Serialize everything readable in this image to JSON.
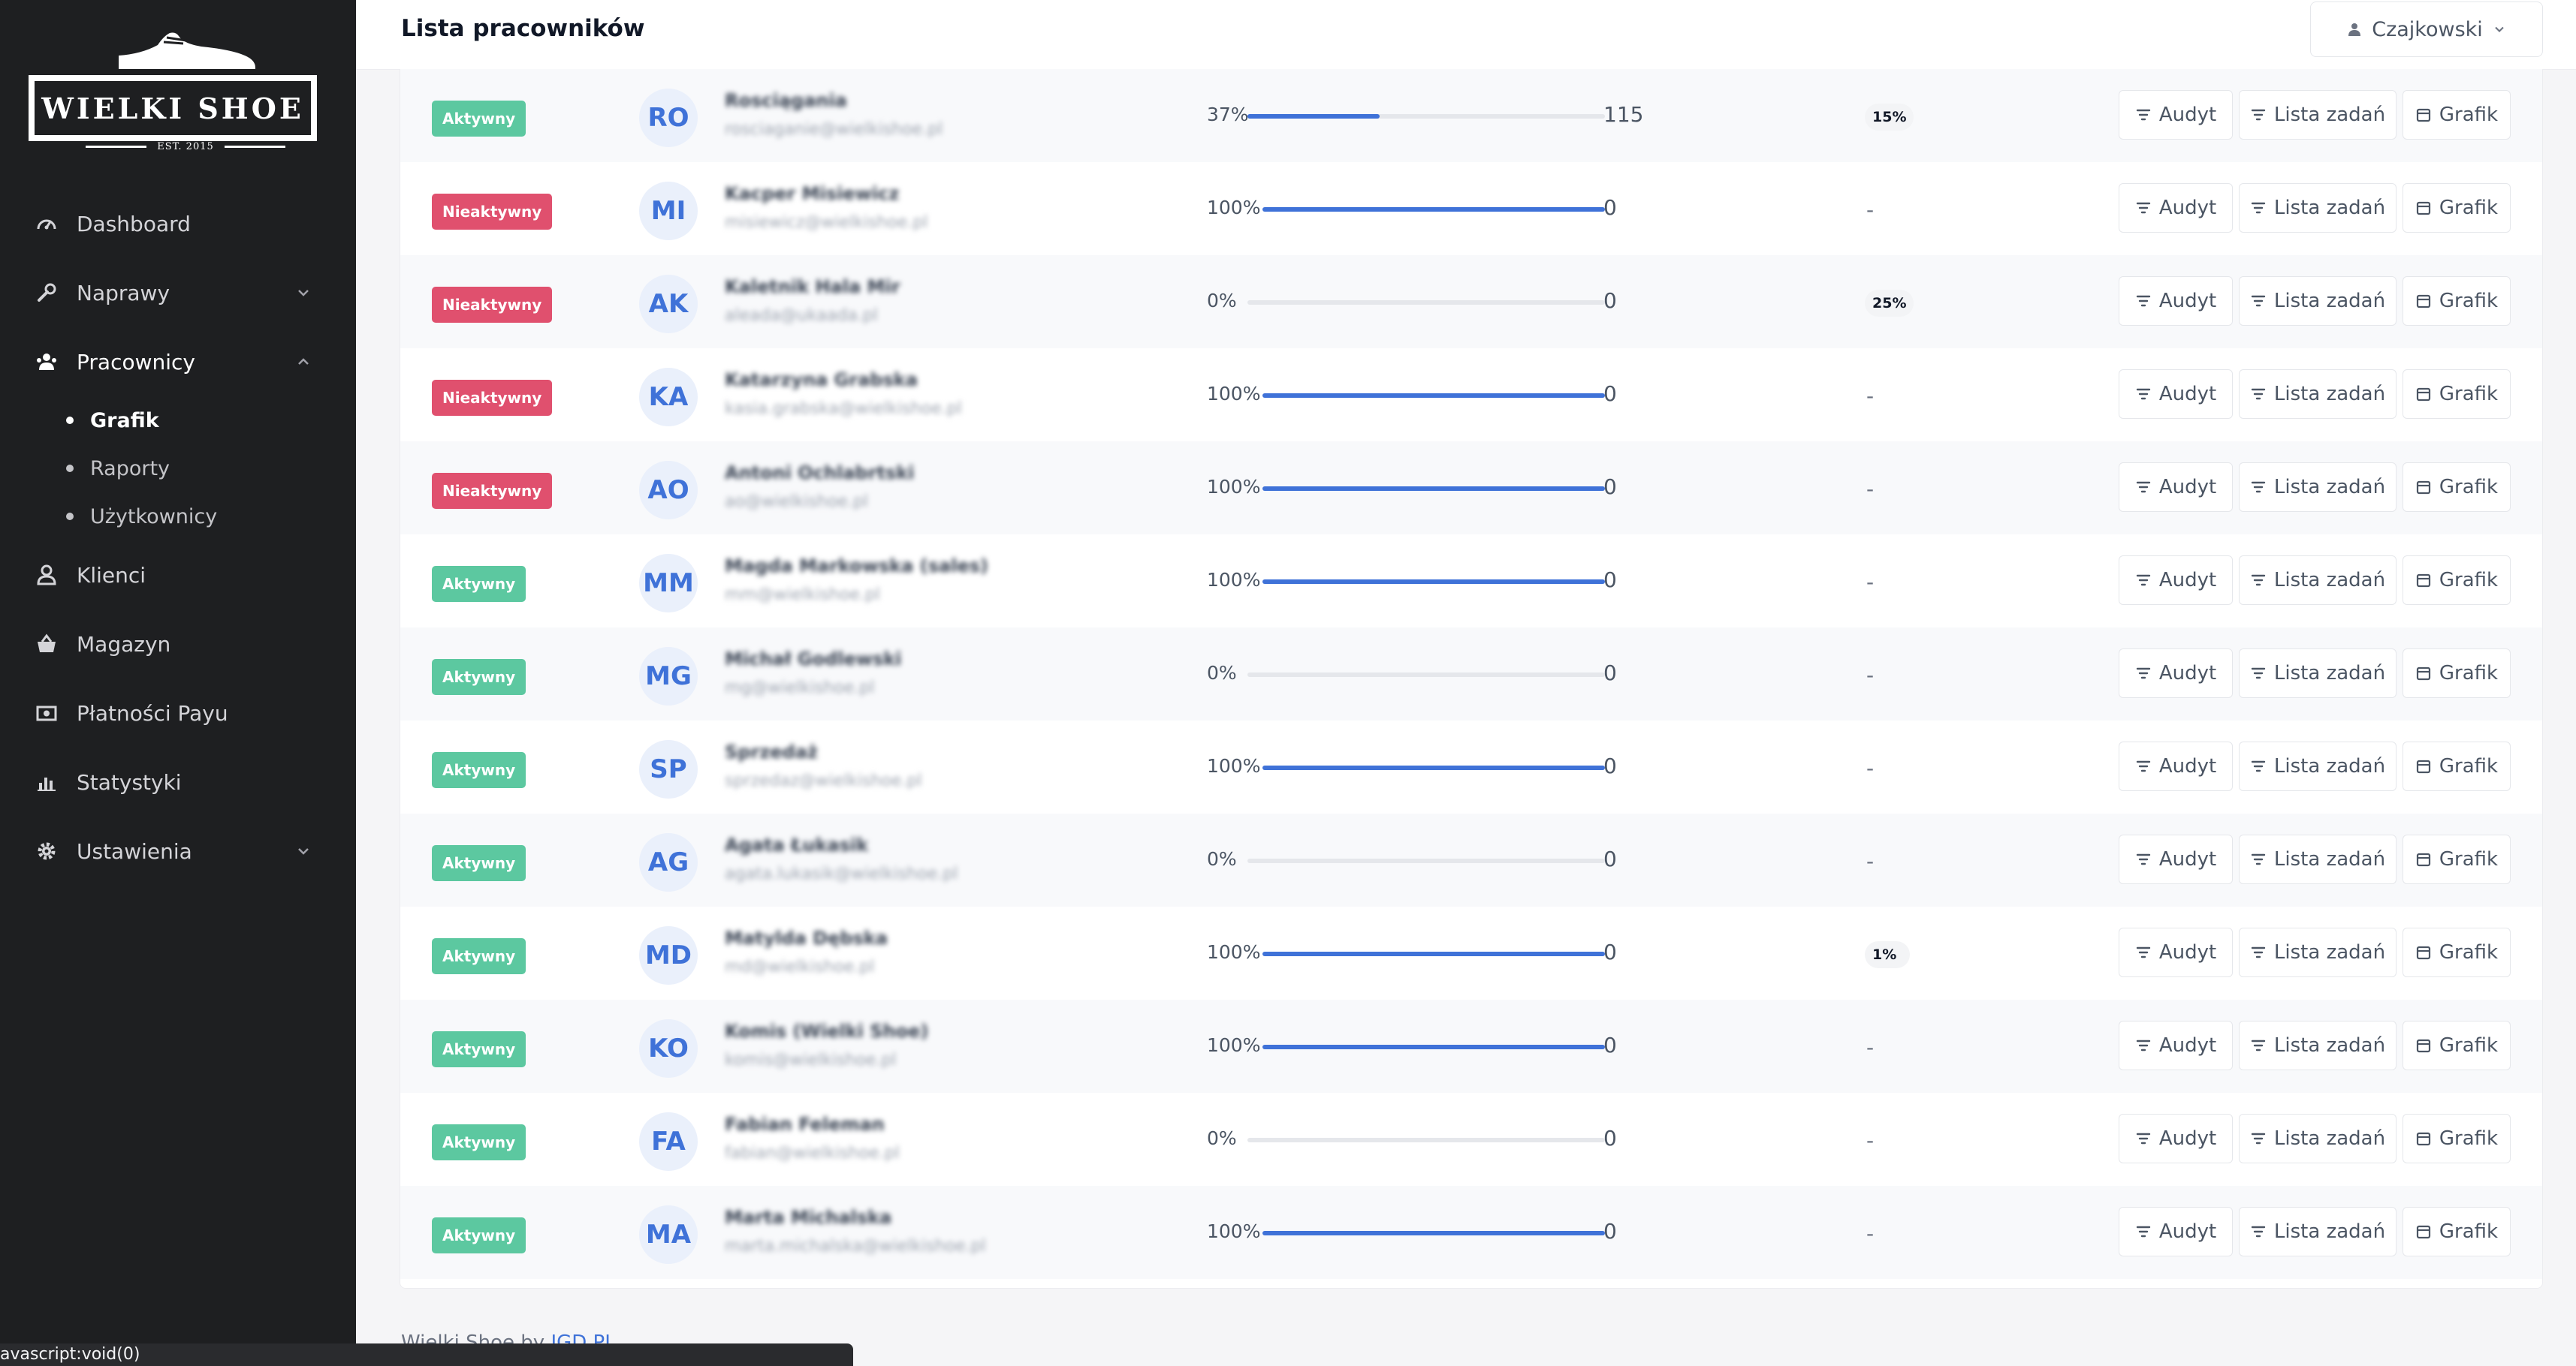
{
  "brand": {
    "logo_text": "WIELKI SHOE",
    "logo_est": "EST. 2015"
  },
  "sidebar": {
    "items": [
      {
        "label": "Dashboard",
        "icon": "gauge-icon"
      },
      {
        "label": "Naprawy",
        "icon": "wrench-icon"
      },
      {
        "label": "Pracownicy",
        "icon": "users-icon"
      },
      {
        "label": "Klienci",
        "icon": "person-icon"
      },
      {
        "label": "Magazyn",
        "icon": "basket-icon"
      },
      {
        "label": "Płatności Payu",
        "icon": "money-icon"
      },
      {
        "label": "Statystyki",
        "icon": "bar-chart-icon"
      },
      {
        "label": "Ustawienia",
        "icon": "gear-icon"
      }
    ],
    "subitems": [
      "Grafik",
      "Raporty",
      "Użytkownicy"
    ]
  },
  "header": {
    "title": "Lista pracowników",
    "user": "Czajkowski"
  },
  "buttons": {
    "audyt": "Audyt",
    "lista": "Lista zadań",
    "grafik": "Grafik"
  },
  "rows": [
    {
      "status": "Aktywny",
      "active": true,
      "initials": "RO",
      "name": "Rosciągania",
      "email": "rosciaganie@wielkishoe.pl",
      "progress": 37,
      "progress_label": "37%",
      "count": "115",
      "pos": "15%"
    },
    {
      "status": "Nieaktywny",
      "active": false,
      "initials": "MI",
      "name": "Kacper Misiewicz",
      "email": "misiewicz@wielkishoe.pl",
      "progress": 100,
      "progress_label": "100%",
      "count": "0",
      "pos": "-"
    },
    {
      "status": "Nieaktywny",
      "active": false,
      "initials": "AK",
      "name": "Kaletnik Hala Mir",
      "email": "aleada@ukaada.pl",
      "progress": 0,
      "progress_label": "0%",
      "count": "0",
      "pos": "25%"
    },
    {
      "status": "Nieaktywny",
      "active": false,
      "initials": "KA",
      "name": "Katarzyna Grabska",
      "email": "kasia.grabska@wielkishoe.pl",
      "progress": 100,
      "progress_label": "100%",
      "count": "0",
      "pos": "-"
    },
    {
      "status": "Nieaktywny",
      "active": false,
      "initials": "AO",
      "name": "Antoni Ochlabrtski",
      "email": "ao@wielkishoe.pl",
      "progress": 100,
      "progress_label": "100%",
      "count": "0",
      "pos": "-"
    },
    {
      "status": "Aktywny",
      "active": true,
      "initials": "MM",
      "name": "Magda Markowska (sales)",
      "email": "mm@wielkishoe.pl",
      "progress": 100,
      "progress_label": "100%",
      "count": "0",
      "pos": "-"
    },
    {
      "status": "Aktywny",
      "active": true,
      "initials": "MG",
      "name": "Michał Godlewski",
      "email": "mg@wielkishoe.pl",
      "progress": 0,
      "progress_label": "0%",
      "count": "0",
      "pos": "-"
    },
    {
      "status": "Aktywny",
      "active": true,
      "initials": "SP",
      "name": "Sprzedaż",
      "email": "sprzedaz@wielkishoe.pl",
      "progress": 100,
      "progress_label": "100%",
      "count": "0",
      "pos": "-"
    },
    {
      "status": "Aktywny",
      "active": true,
      "initials": "AG",
      "name": "Agata Łukasik",
      "email": "agata.lukasik@wielkishoe.pl",
      "progress": 0,
      "progress_label": "0%",
      "count": "0",
      "pos": "-"
    },
    {
      "status": "Aktywny",
      "active": true,
      "initials": "MD",
      "name": "Matylda Dębska",
      "email": "md@wielkishoe.pl",
      "progress": 100,
      "progress_label": "100%",
      "count": "0",
      "pos": "1%"
    },
    {
      "status": "Aktywny",
      "active": true,
      "initials": "KO",
      "name": "Komis (Wielki Shoe)",
      "email": "komis@wielkishoe.pl",
      "progress": 100,
      "progress_label": "100%",
      "count": "0",
      "pos": "-"
    },
    {
      "status": "Aktywny",
      "active": true,
      "initials": "FA",
      "name": "Fabian Feleman",
      "email": "fabian@wielkishoe.pl",
      "progress": 0,
      "progress_label": "0%",
      "count": "0",
      "pos": "-"
    },
    {
      "status": "Aktywny",
      "active": true,
      "initials": "MA",
      "name": "Marta Michalska",
      "email": "marta.michalska@wielkishoe.pl",
      "progress": 100,
      "progress_label": "100%",
      "count": "0",
      "pos": "-"
    }
  ],
  "footer": {
    "text": "Wielki Shoe by",
    "link": "JGD.PL"
  },
  "statusbar": "avascript:void(0)",
  "colors": {
    "sidebar_bg": "#1e1f21",
    "accent": "#3f72d8",
    "active": "#5cc8a0",
    "inactive": "#e0506e"
  }
}
